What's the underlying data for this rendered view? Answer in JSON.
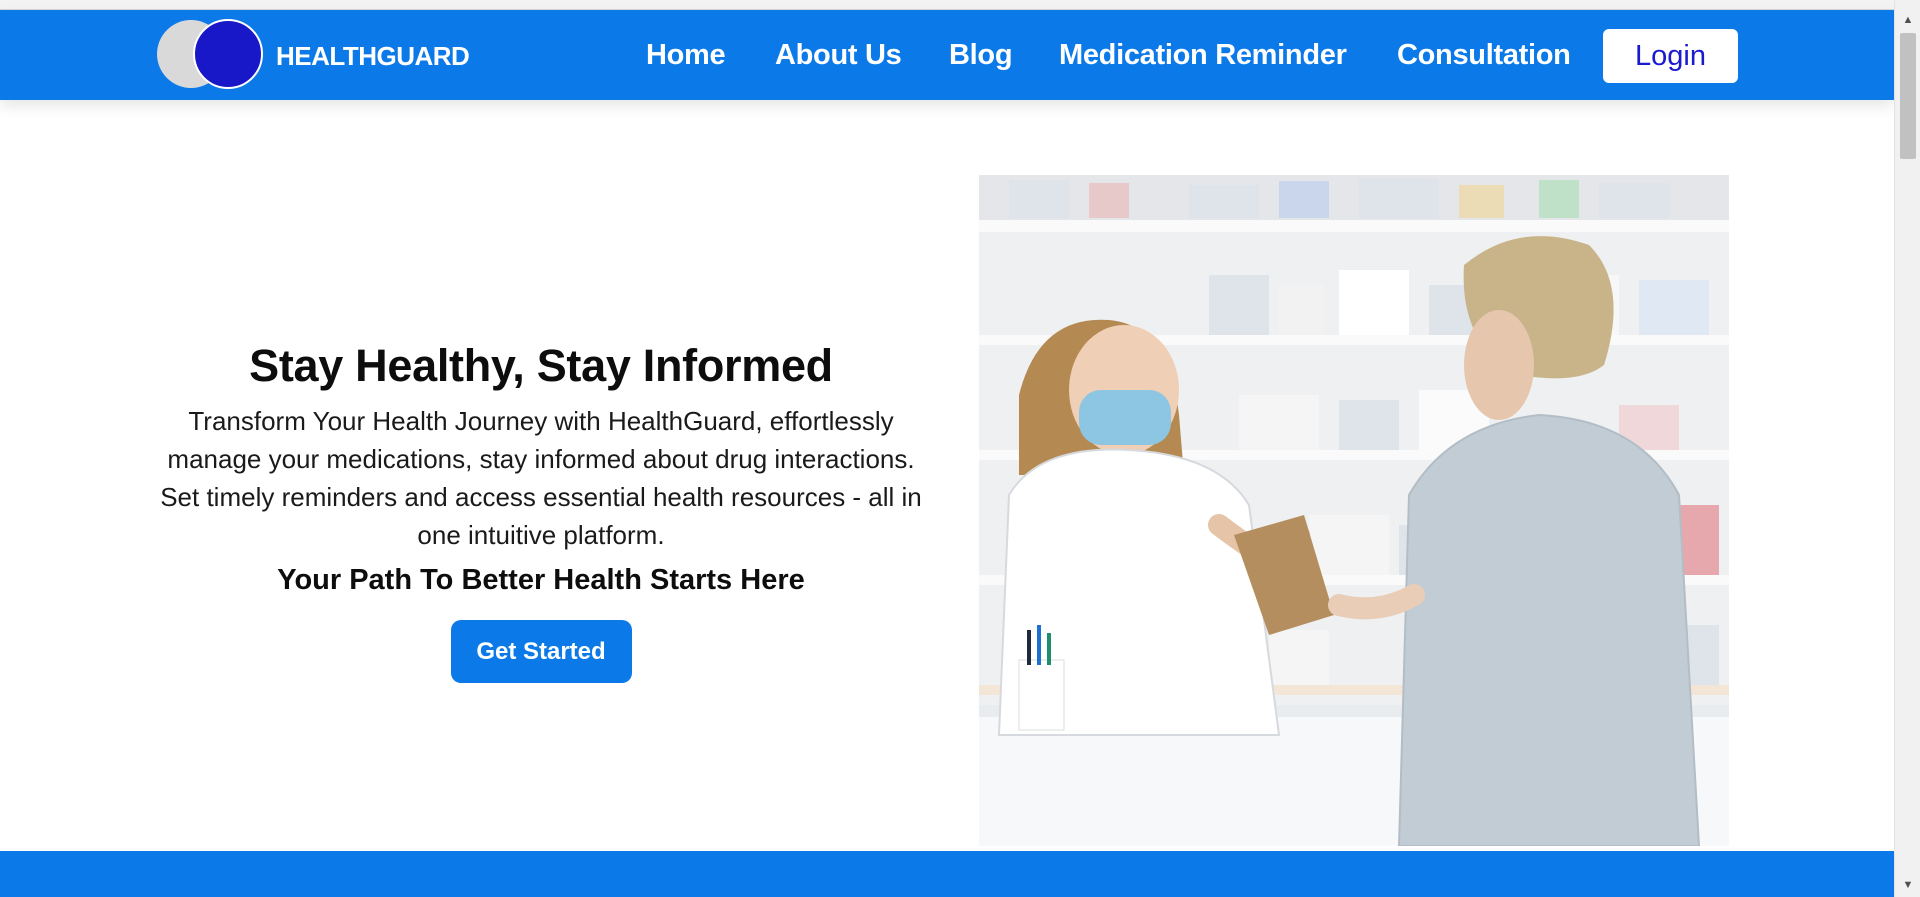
{
  "colors": {
    "primary": "#0b7ae8",
    "logo_dark": "#1818c8",
    "logo_light": "#d9d9d9",
    "login_text": "#1a1ad0",
    "text": "#111111"
  },
  "header": {
    "brand": "HEALTHGUARD",
    "logo_icon": "two-circles-logo",
    "nav_links": [
      "Home",
      "About Us",
      "Blog",
      "Medication Reminder",
      "Consultation"
    ],
    "login_label": "Login"
  },
  "hero": {
    "title": "Stay Healthy, Stay Informed",
    "description": "Transform Your Health Journey with HealthGuard, effortlessly manage your medications, stay informed about drug interactions. Set timely reminders and access essential health resources - all in one intuitive platform.",
    "tagline": "Your Path To Better Health Starts Here",
    "cta_label": "Get Started",
    "image_subject": "pharmacist-handing-bag-to-customer-photo"
  },
  "scrollbar": {
    "up_icon": "triangle-up-icon",
    "down_icon": "triangle-down-icon"
  }
}
